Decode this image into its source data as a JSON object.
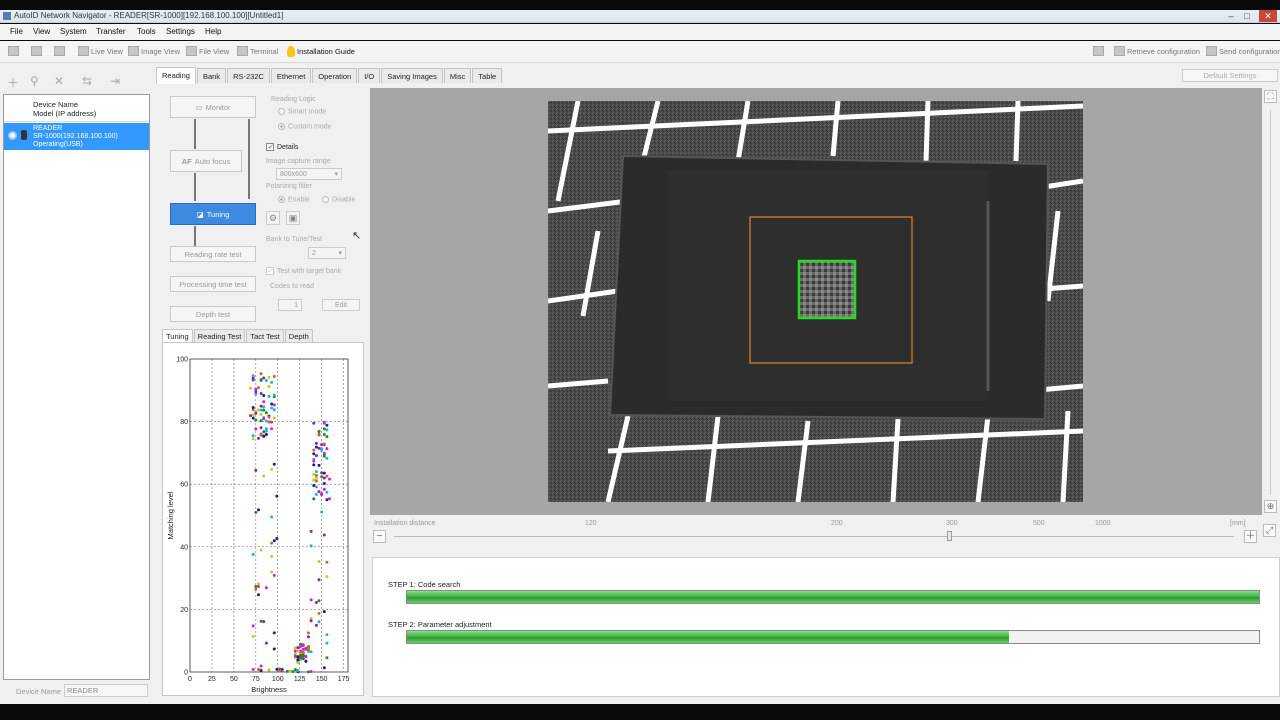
{
  "window": {
    "title": "AutoID Network Navigator - READER[SR-1000][192.168.100.100][Untitled1]"
  },
  "menu": [
    "File",
    "View",
    "System",
    "Transfer",
    "Tools",
    "Settings",
    "Help"
  ],
  "toolbar": {
    "live_view": "Live View",
    "image_view": "Image View",
    "file_view": "File View",
    "terminal": "Terminal",
    "installation_guide": "Installation Guide",
    "retrieve": "Retrieve configuration",
    "send": "Send configuration",
    "default_settings": "Default Settings"
  },
  "devices": {
    "header_line1": "Device Name",
    "header_line2": "Model (IP address)",
    "row": {
      "name": "READER",
      "model": "SR-1000(192.168.100.100)",
      "status": "Operating(USB)"
    },
    "device_name_label": "Device Name",
    "device_name_value": "READER"
  },
  "tabs": [
    "Reading",
    "Bank",
    "RS-232C",
    "Ethernet",
    "Operation",
    "I/O",
    "Saving Images",
    "Misc",
    "Table"
  ],
  "flow": {
    "monitor": "Monitor",
    "autofocus": "Auto focus",
    "tuning": "Tuning",
    "reading_rate": "Reading rate test",
    "processing_time": "Processing time test",
    "depth": "Depth test"
  },
  "settings": {
    "reading_logic": "Reading Logic",
    "smart_mode": "Smart mode",
    "custom_mode": "Custom mode",
    "details": "Details",
    "capture_range": "Image capture range",
    "capture_value": "800x600",
    "polarizing": "Polarizing filter",
    "enable": "Enable",
    "disable": "Disable",
    "bank_to_tune": "Bank to Tune/Test",
    "bank_value": "2",
    "test_with_bank": "Test with target bank",
    "codes_to_read": "Codes to read",
    "codes_value": "1",
    "edit": "Edit"
  },
  "chart_tabs": [
    "Tuning",
    "Reading Test",
    "Tact Test",
    "Depth"
  ],
  "chart_data": {
    "type": "scatter",
    "xlabel": "Brightness",
    "ylabel": "Matching level",
    "xlim": [
      0,
      180
    ],
    "ylim": [
      0,
      100
    ],
    "xticks": [
      0,
      25,
      50,
      75,
      100,
      125,
      150,
      175
    ],
    "yticks": [
      0,
      20,
      40,
      60,
      80,
      100
    ],
    "colors": [
      "#d41ed4",
      "#1eb4d4",
      "#1e1e8c",
      "#c8c81e",
      "#8c1ec8",
      "#1e8c1e",
      "#d4641e"
    ],
    "clusters": [
      {
        "x_range": [
          70,
          97
        ],
        "y_range": [
          74,
          96
        ],
        "count": 70
      },
      {
        "x_range": [
          70,
          100
        ],
        "y_range": [
          0,
          70
        ],
        "count": 30
      },
      {
        "x_range": [
          120,
          135
        ],
        "y_range": [
          3,
          9
        ],
        "count": 45
      },
      {
        "x_range": [
          140,
          158
        ],
        "y_range": [
          55,
          80
        ],
        "count": 55
      },
      {
        "x_range": [
          135,
          158
        ],
        "y_range": [
          0,
          55
        ],
        "count": 25
      },
      {
        "x_range": [
          70,
          140
        ],
        "y_range": [
          0,
          1
        ],
        "count": 18
      }
    ]
  },
  "viewer": {
    "installation_distance": "Installation distance",
    "ticks": [
      "120",
      "200",
      "300",
      "500",
      "1000"
    ],
    "unit": "[mm]"
  },
  "steps": [
    {
      "label": "STEP 1: Code search",
      "progress": 1.0
    },
    {
      "label": "STEP 2: Parameter adjustment",
      "progress": 0.707
    }
  ]
}
